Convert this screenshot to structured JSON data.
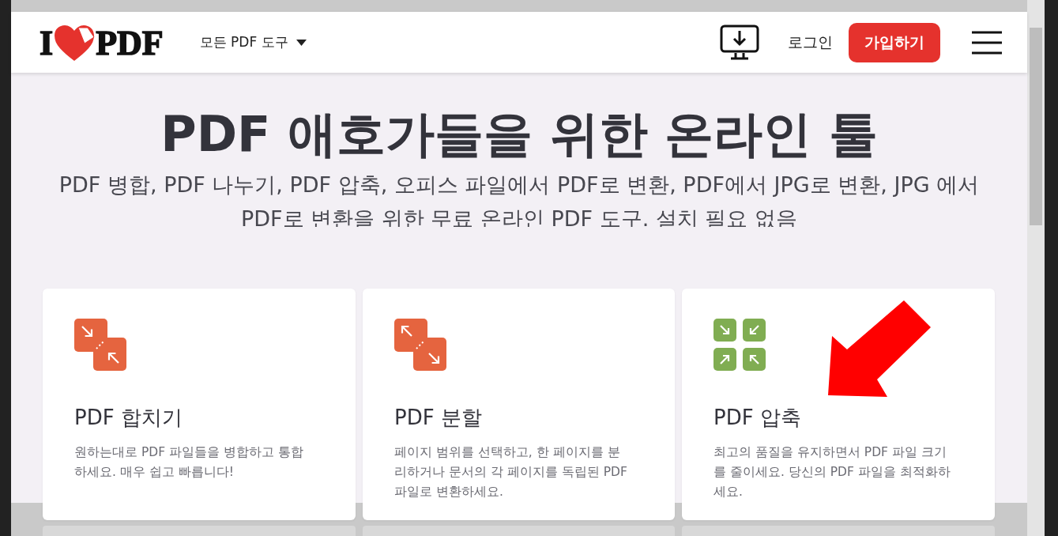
{
  "header": {
    "logo": {
      "left": "I",
      "right": "PDF"
    },
    "nav": {
      "label": "모든 PDF 도구"
    },
    "login": "로그인",
    "signup": "가입하기"
  },
  "hero": {
    "title": "PDF 애호가들을 위한 온라인 툴",
    "subtitle": "PDF 병합, PDF 나누기, PDF 압축, 오피스 파일에서 PDF로 변환, PDF에서 JPG로 변환, JPG 에서 PDF로 변환을 위한 무료 온라인 PDF 도구. 설치 필요 없음"
  },
  "tools": [
    {
      "kind": "merge",
      "color": "#e5643f",
      "title": "PDF 합치기",
      "description": "원하는대로 PDF 파일들을 병합하고 통합하세요. 매우 쉽고 빠릅니다!"
    },
    {
      "kind": "split",
      "color": "#e5643f",
      "title": "PDF 분할",
      "description": "페이지 범위를 선택하고, 한 페이지를 분리하거나 문서의 각 페이지를 독립된 PDF 파일로 변환하세요."
    },
    {
      "kind": "compress",
      "color": "#80ad52",
      "title": "PDF 압축",
      "description": "최고의 품질을 유지하면서 PDF 파일 크기를 줄이세요. 당신의 PDF 파일을 최적화하세요."
    }
  ]
}
